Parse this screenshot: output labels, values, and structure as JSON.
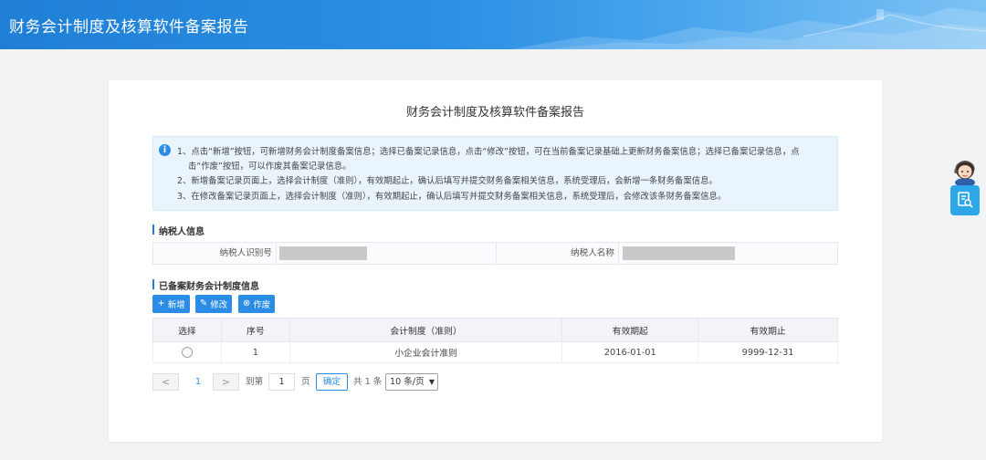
{
  "header": {
    "title": "财务会计制度及核算软件备案报告"
  },
  "card": {
    "title": "财务会计制度及核算软件备案报告"
  },
  "notice": {
    "line1": "1、点击“新增”按钮，可新增财务会计制度备案信息；选择已备案记录信息，点击“修改”按钮，可在当前备案记录基础上更新财务备案信息；选择已备案记录信息，点",
    "line1b": "击“作废”按钮，可以作废其备案记录信息。",
    "line2": "2、新增备案记录页面上，选择会计制度（准则），有效期起止，确认后填写并提交财务备案相关信息，系统受理后，会新增一条财务备案信息。",
    "line3": "3、在修改备案记录页面上，选择会计制度（准则），有效期起止，确认后填写并提交财务备案相关信息，系统受理后，会修改该条财务备案信息。"
  },
  "taxpayer": {
    "section": "纳税人信息",
    "id_label": "纳税人识别号",
    "name_label": "纳税人名称"
  },
  "records": {
    "section": "已备案财务会计制度信息",
    "buttons": {
      "add": "新增",
      "edit": "修改",
      "void": "作废"
    },
    "columns": [
      "选择",
      "序号",
      "会计制度（准则）",
      "有效期起",
      "有效期止"
    ],
    "rows": [
      {
        "index": "1",
        "standard": "小企业会计准则",
        "start": "2016-01-01",
        "end": "9999-12-31"
      }
    ]
  },
  "pager": {
    "prev": "<",
    "current": "1",
    "next": ">",
    "goto_label": "到第",
    "goto_value": "1",
    "page_unit": "页",
    "confirm": "确定",
    "total": "共 1 条",
    "page_size": "10 条/页"
  },
  "side": {
    "icon": "document-search-icon"
  }
}
